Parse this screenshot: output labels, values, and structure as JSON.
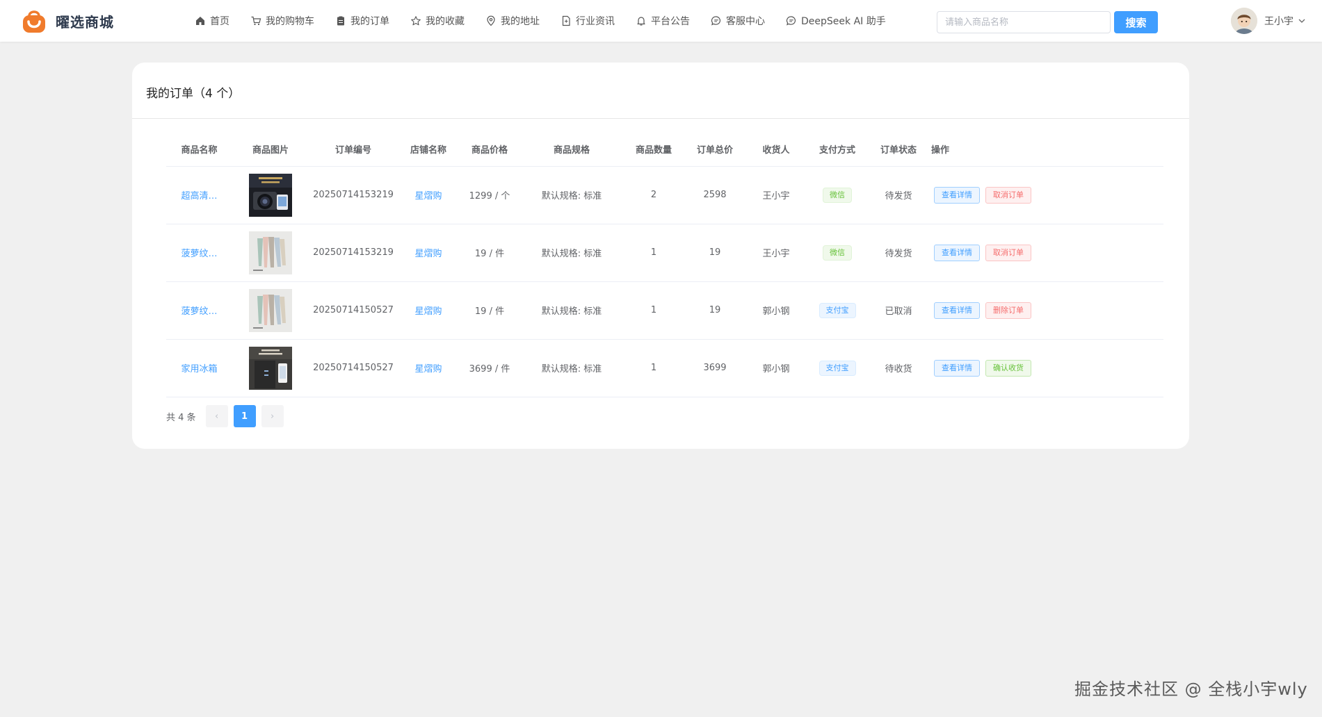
{
  "app": {
    "name": "曜选商城",
    "brand_color": "#f07b2c",
    "accent": "#409eff"
  },
  "nav": [
    {
      "label": "首页",
      "icon": "home-icon"
    },
    {
      "label": "我的购物车",
      "icon": "cart-icon"
    },
    {
      "label": "我的订单",
      "icon": "clipboard-icon"
    },
    {
      "label": "我的收藏",
      "icon": "star-icon"
    },
    {
      "label": "我的地址",
      "icon": "location-pin-icon"
    },
    {
      "label": "行业资讯",
      "icon": "document-icon"
    },
    {
      "label": "平台公告",
      "icon": "bell-icon"
    },
    {
      "label": "客服中心",
      "icon": "chat-bubble-icon"
    },
    {
      "label": "DeepSeek AI 助手",
      "icon": "chat-bubble-icon"
    }
  ],
  "search": {
    "placeholder": "请输入商品名称",
    "value": "",
    "button_label": "搜索"
  },
  "user": {
    "name": "王小宇"
  },
  "orders": {
    "title": "我的订单（4 个）",
    "columns": [
      "商品名称",
      "商品图片",
      "订单编号",
      "店铺名称",
      "商品价格",
      "商品规格",
      "商品数量",
      "订单总价",
      "收货人",
      "支付方式",
      "订单状态",
      "操作"
    ],
    "rows": [
      {
        "name": "超高清…",
        "image": "camera-product-image",
        "order_no": "20250714153219",
        "shop": "星熠购",
        "price": "1299 / 个",
        "spec": "默认规格: 标准",
        "qty": "2",
        "total": "2598",
        "receiver": "王小宇",
        "payment": "微信",
        "payment_color": "green",
        "status": "待发货",
        "actions": [
          {
            "label": "查看详情",
            "style": "blue"
          },
          {
            "label": "取消订单",
            "style": "red"
          }
        ]
      },
      {
        "name": "菠萝纹…",
        "image": "towel-product-image",
        "order_no": "20250714153219",
        "shop": "星熠购",
        "price": "19 / 件",
        "spec": "默认规格: 标准",
        "qty": "1",
        "total": "19",
        "receiver": "王小宇",
        "payment": "微信",
        "payment_color": "green",
        "status": "待发货",
        "actions": [
          {
            "label": "查看详情",
            "style": "blue"
          },
          {
            "label": "取消订单",
            "style": "red"
          }
        ]
      },
      {
        "name": "菠萝纹…",
        "image": "towel-product-image",
        "order_no": "20250714150527",
        "shop": "星熠购",
        "price": "19 / 件",
        "spec": "默认规格: 标准",
        "qty": "1",
        "total": "19",
        "receiver": "郭小钢",
        "payment": "支付宝",
        "payment_color": "blue",
        "status": "已取消",
        "actions": [
          {
            "label": "查看详情",
            "style": "blue"
          },
          {
            "label": "删除订单",
            "style": "red"
          }
        ]
      },
      {
        "name": "家用冰箱",
        "image": "fridge-product-image",
        "order_no": "20250714150527",
        "shop": "星熠购",
        "price": "3699 / 件",
        "spec": "默认规格: 标准",
        "qty": "1",
        "total": "3699",
        "receiver": "郭小钢",
        "payment": "支付宝",
        "payment_color": "blue",
        "status": "待收货",
        "actions": [
          {
            "label": "查看详情",
            "style": "blue"
          },
          {
            "label": "确认收货",
            "style": "green"
          }
        ]
      }
    ]
  },
  "pagination": {
    "total_text": "共 4 条",
    "current_page": "1",
    "prev": "‹",
    "next": "›"
  },
  "watermark": "掘金技术社区 @ 全栈小宇wly"
}
